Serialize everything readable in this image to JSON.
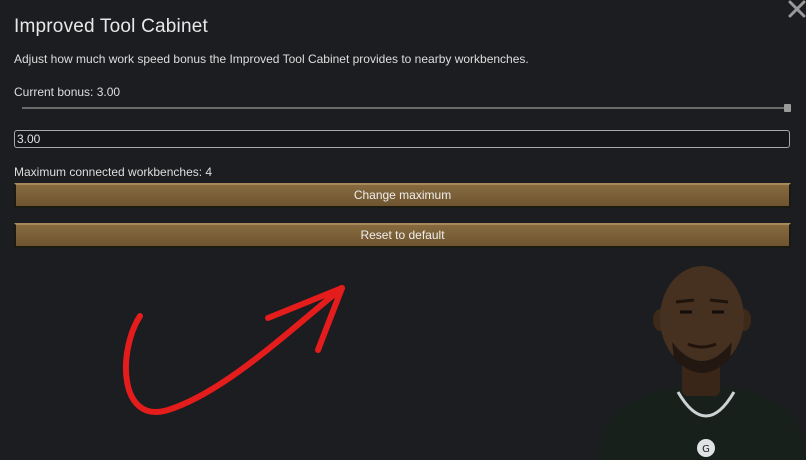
{
  "dialog": {
    "title": "Improved Tool Cabinet",
    "description": "Adjust how much work speed bonus the Improved Tool Cabinet provides to nearby workbenches.",
    "current_bonus_label": "Current bonus: 3.00",
    "slider": {
      "value": 3.0,
      "min": 0,
      "max": 3.0
    },
    "bonus_input_value": "3.00",
    "max_connected_label": "Maximum connected workbenches: 4",
    "change_maximum_label": "Change maximum",
    "reset_default_label": "Reset to default",
    "close_icon": "close-x-icon"
  },
  "overlay": {
    "arrow_color": "#e51c1c",
    "photo_icon": "person-photo"
  },
  "colors": {
    "background": "#1b1d20",
    "button": "#7a5e36"
  }
}
